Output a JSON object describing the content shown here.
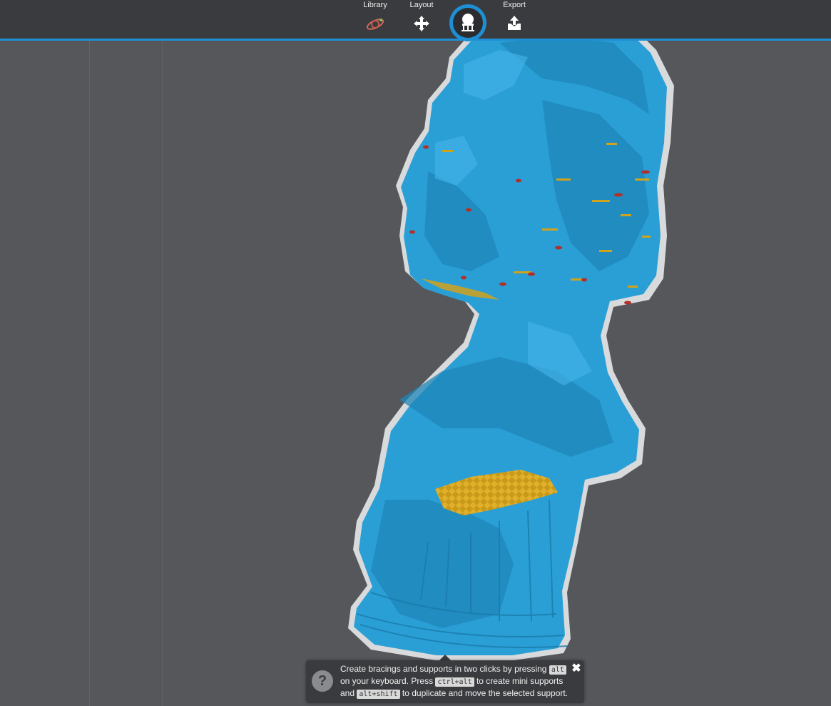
{
  "toolbar": {
    "tabs": [
      {
        "label": "Library",
        "icon": "library-icon"
      },
      {
        "label": "Layout",
        "icon": "move-icon"
      },
      {
        "label": "",
        "icon": "supports-icon",
        "active": true
      },
      {
        "label": "Export",
        "icon": "export-icon"
      }
    ],
    "accent_color": "#1e8fd4"
  },
  "viewport": {
    "model_color": "#2a9fd6",
    "overhang_color": "#d1a21b",
    "background_color": "#56575b"
  },
  "hint": {
    "line1_pre": "Create bracings and supports in two clicks by pressing",
    "key_alt": "alt",
    "line2_pre": "on your keyboard. Press",
    "key_ctrl_alt": "ctrl+alt",
    "line2_post": "to create mini supports",
    "line3_pre": "and",
    "key_alt_shift": "alt+shift",
    "line3_post": "to duplicate and move the selected support.",
    "help_icon_text": "?",
    "close_icon_text": "✖"
  }
}
